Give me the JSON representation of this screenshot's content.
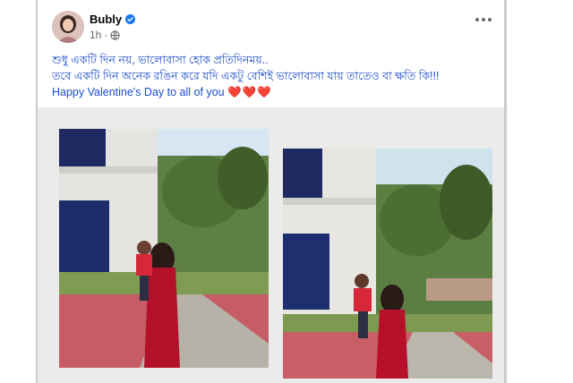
{
  "post": {
    "author": "Bubly",
    "timestamp": "1h",
    "separator": "·",
    "text_lines": [
      "শুধু একটি দিন নয়, ভালোবাসা হোক প্রতিদিনময়..",
      "তবে একটি দিন অনেক রঙিন করে যদি একটু বেশিই ভালোবাসা যায় তাতেও বা ক্ষতি কি!!!",
      "Happy Valentine's Day to all of you"
    ],
    "hearts": "❤️❤️❤️"
  },
  "icons": {
    "verified": "verified-badge-icon",
    "audience": "globe-icon",
    "more": "more-options-icon"
  },
  "colors": {
    "text_blue": "#1c4cc9",
    "verified_blue": "#1877f2",
    "media_bg": "#ebebeb"
  }
}
